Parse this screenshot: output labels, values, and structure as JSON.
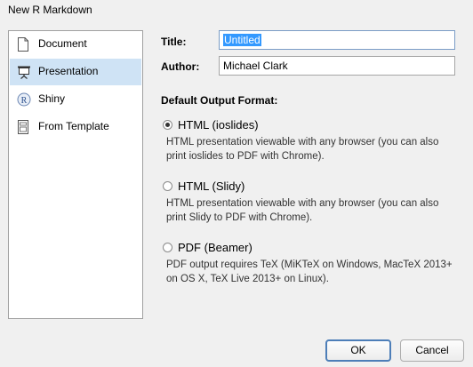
{
  "window": {
    "title": "New R Markdown"
  },
  "sidebar": {
    "items": [
      {
        "label": "Document",
        "icon": "document-icon",
        "selected": false
      },
      {
        "label": "Presentation",
        "icon": "presentation-icon",
        "selected": true
      },
      {
        "label": "Shiny",
        "icon": "shiny-r-icon",
        "selected": false
      },
      {
        "label": "From Template",
        "icon": "template-icon",
        "selected": false
      }
    ]
  },
  "form": {
    "title_label": "Title:",
    "title_value": "Untitled",
    "author_label": "Author:",
    "author_value": "Michael Clark"
  },
  "output_format": {
    "heading": "Default Output Format:",
    "options": [
      {
        "label": "HTML (ioslides)",
        "checked": true,
        "description": "HTML presentation viewable with any browser (you can also print ioslides to PDF with Chrome)."
      },
      {
        "label": "HTML (Slidy)",
        "checked": false,
        "description": "HTML presentation viewable with any browser (you can also print Slidy to PDF with Chrome)."
      },
      {
        "label": "PDF (Beamer)",
        "checked": false,
        "description": "PDF output requires TeX (MiKTeX on Windows, MacTeX 2013+ on OS X, TeX Live 2013+ on Linux)."
      }
    ]
  },
  "buttons": {
    "ok": "OK",
    "cancel": "Cancel"
  },
  "colors": {
    "selection": "#cfe3f5",
    "text_highlight": "#3399ff",
    "default_button_border": "#4d7eb8"
  }
}
